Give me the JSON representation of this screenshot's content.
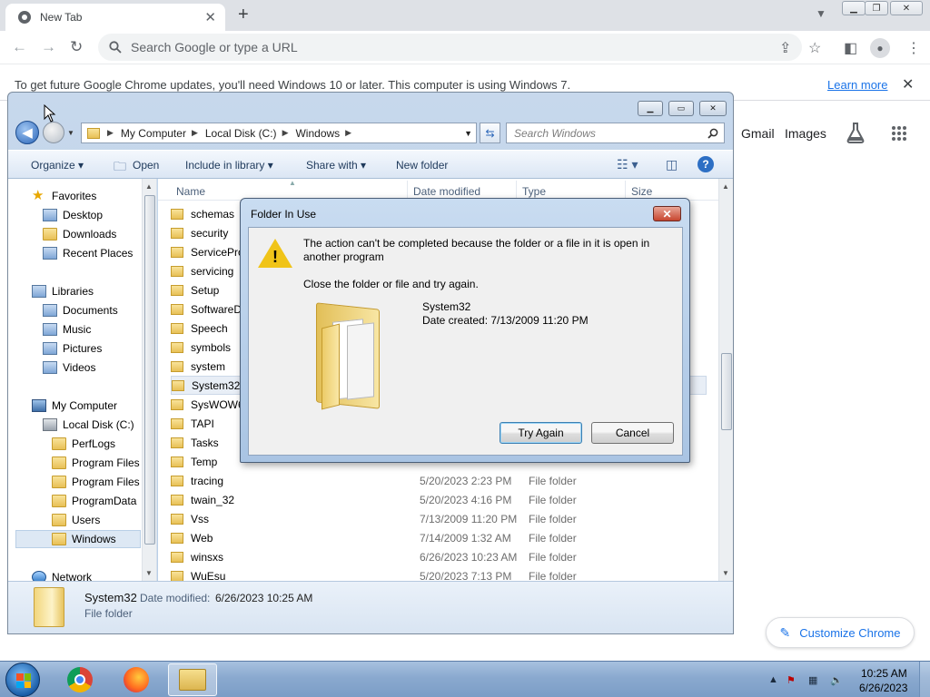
{
  "browser": {
    "tab_title": "New Tab",
    "omnibox_placeholder": "Search Google or type a URL",
    "infobar_text": "To get future Google Chrome updates, you'll need Windows 10 or later. This computer is using Windows 7.",
    "infobar_link": "Learn more",
    "ntp_links": [
      "Gmail",
      "Images"
    ],
    "customize_label": "Customize Chrome"
  },
  "explorer": {
    "address": [
      "My Computer",
      "Local Disk (C:)",
      "Windows"
    ],
    "search_placeholder": "Search Windows",
    "commands": {
      "organize": "Organize",
      "open": "Open",
      "include": "Include in library",
      "share": "Share with",
      "new_folder": "New folder"
    },
    "nav": {
      "favorites": "Favorites",
      "favorite_items": [
        "Desktop",
        "Downloads",
        "Recent Places"
      ],
      "libraries": "Libraries",
      "library_items": [
        "Documents",
        "Music",
        "Pictures",
        "Videos"
      ],
      "computer": "My Computer",
      "disk": "Local Disk (C:)",
      "disk_items": [
        "PerfLogs",
        "Program Files",
        "Program Files (",
        "ProgramData",
        "Users",
        "Windows"
      ],
      "network": "Network",
      "selected": "Windows"
    },
    "columns": {
      "name": "Name",
      "date": "Date modified",
      "type": "Type",
      "size": "Size"
    },
    "rows": [
      {
        "name": "schemas",
        "date": "",
        "type": ""
      },
      {
        "name": "security",
        "date": "",
        "type": ""
      },
      {
        "name": "ServiceProfiles",
        "date": "",
        "type": ""
      },
      {
        "name": "servicing",
        "date": "",
        "type": ""
      },
      {
        "name": "Setup",
        "date": "",
        "type": ""
      },
      {
        "name": "SoftwareDistribution",
        "date": "",
        "type": ""
      },
      {
        "name": "Speech",
        "date": "",
        "type": ""
      },
      {
        "name": "symbols",
        "date": "",
        "type": ""
      },
      {
        "name": "system",
        "date": "",
        "type": ""
      },
      {
        "name": "System32",
        "date": "",
        "type": ""
      },
      {
        "name": "SysWOW64",
        "date": "",
        "type": ""
      },
      {
        "name": "TAPI",
        "date": "",
        "type": ""
      },
      {
        "name": "Tasks",
        "date": "",
        "type": ""
      },
      {
        "name": "Temp",
        "date": "",
        "type": ""
      },
      {
        "name": "tracing",
        "date": "5/20/2023 2:23 PM",
        "type": "File folder"
      },
      {
        "name": "twain_32",
        "date": "5/20/2023 4:16 PM",
        "type": "File folder"
      },
      {
        "name": "Vss",
        "date": "7/13/2009 11:20 PM",
        "type": "File folder"
      },
      {
        "name": "Web",
        "date": "7/14/2009 1:32 AM",
        "type": "File folder"
      },
      {
        "name": "winsxs",
        "date": "6/26/2023 10:23 AM",
        "type": "File folder"
      },
      {
        "name": "WuEsu",
        "date": "5/20/2023 7:13 PM",
        "type": "File folder"
      }
    ],
    "selected_row": "System32",
    "details": {
      "name": "System32",
      "modified_label": "Date modified:",
      "modified_value": "6/26/2023 10:25 AM",
      "type": "File folder"
    }
  },
  "dialog": {
    "title": "Folder In Use",
    "message": "The action can't be completed because the folder or a file in it is open in another program",
    "hint": "Close the folder or file and try again.",
    "folder_name": "System32",
    "folder_date": "Date created: 7/13/2009 11:20 PM",
    "try_again": "Try Again",
    "cancel": "Cancel"
  },
  "taskbar": {
    "time": "10:25 AM",
    "date": "6/26/2023"
  }
}
